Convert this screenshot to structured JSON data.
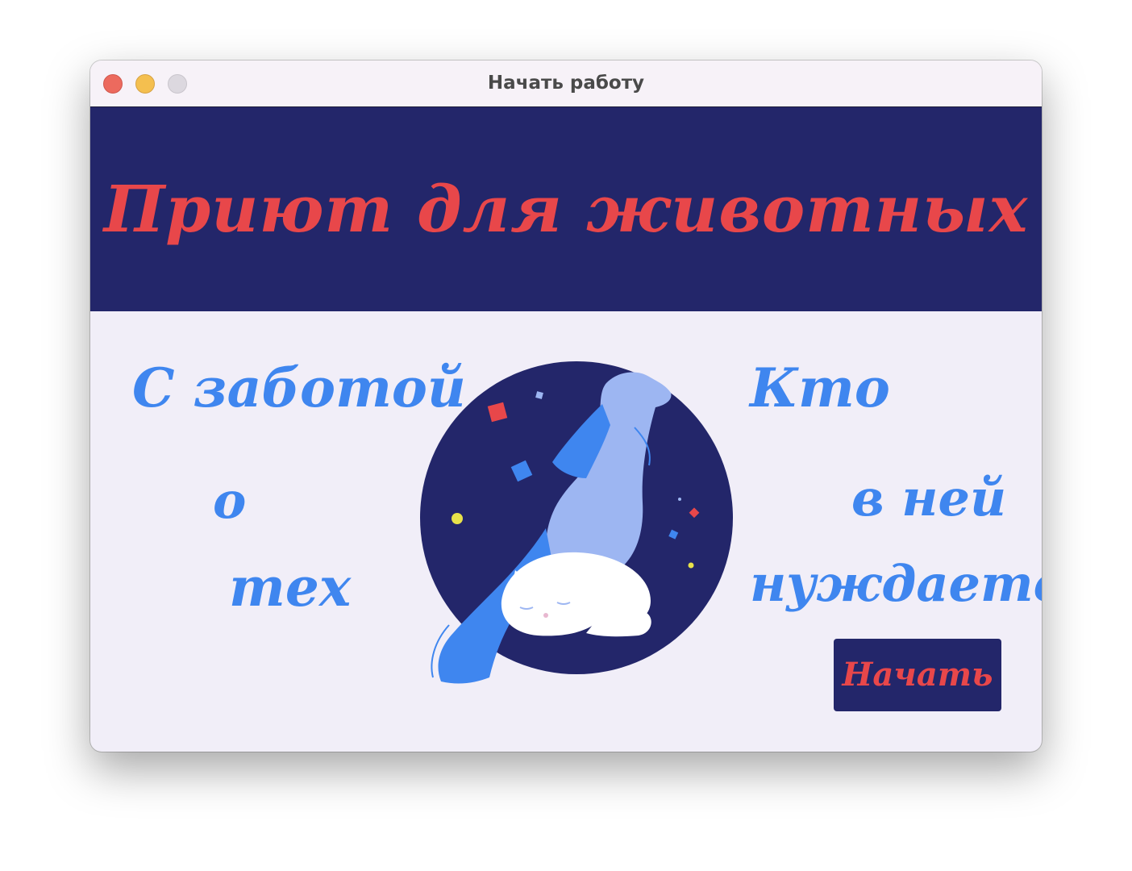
{
  "window": {
    "title": "Начать работу"
  },
  "header": {
    "title": "Приют для животных"
  },
  "left_slogan": {
    "line1": "С заботой",
    "line2": "о",
    "line3": "тех"
  },
  "right_slogan": {
    "line1": "Кто",
    "line2": "в ней",
    "line3": "нуждается"
  },
  "illustration": {
    "icon": "dog-and-cat-illustration"
  },
  "start_button": {
    "label": "Начать"
  },
  "colors": {
    "header_bg": "#23266a",
    "title_red": "#e8474a",
    "accent_blue": "#3f86ef",
    "content_bg": "#f1eef8",
    "titlebar_bg": "#f7f2f8"
  }
}
